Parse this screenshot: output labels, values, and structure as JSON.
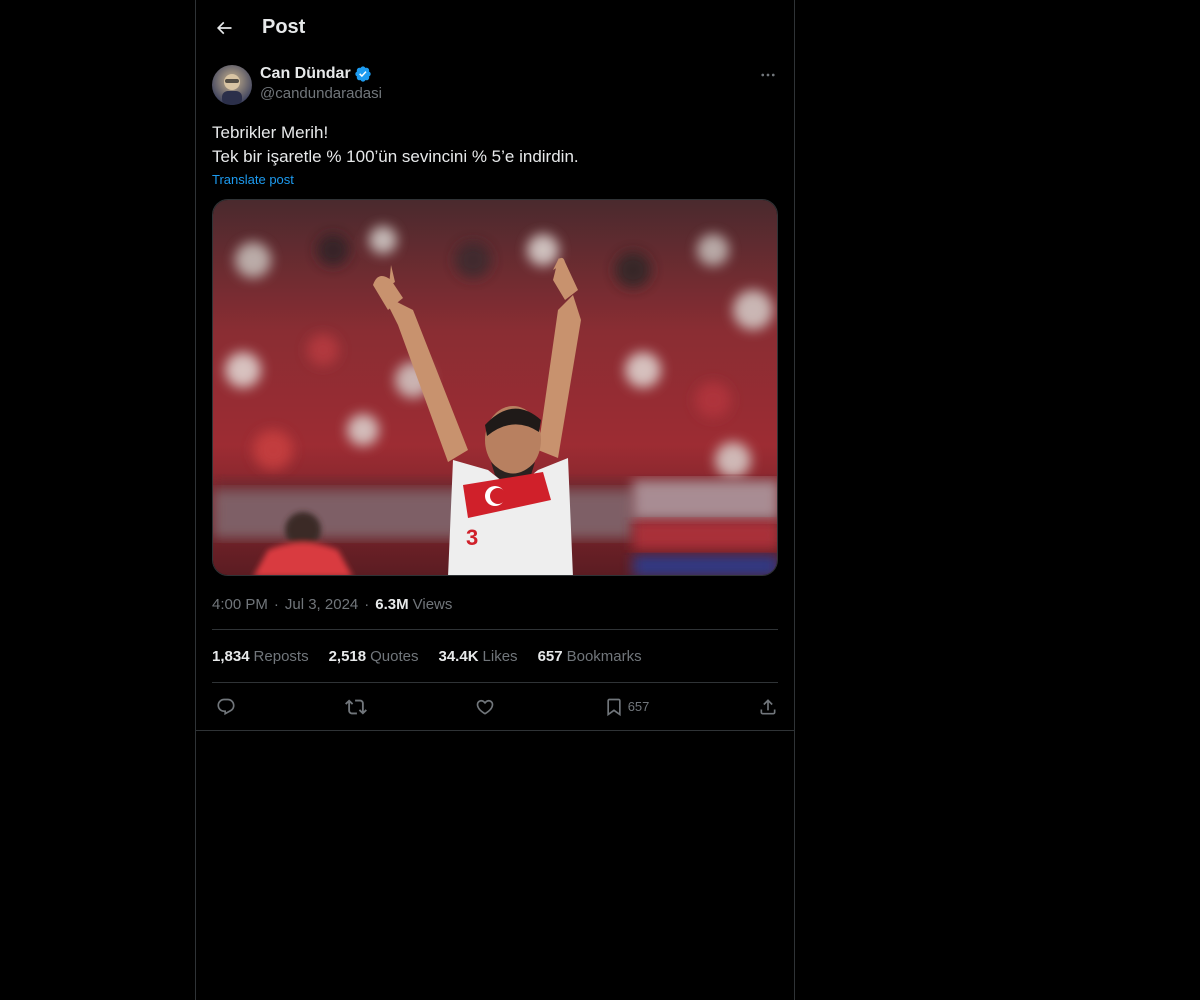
{
  "header": {
    "title": "Post"
  },
  "post": {
    "author": {
      "display_name": "Can Dündar",
      "handle": "@candundaradasi",
      "verified": true
    },
    "text_line1": "Tebrikler Merih!",
    "text_line2": "Tek bir işaretle % 100’ün sevincini % 5’e indirdin.",
    "translate_label": "Translate post",
    "time": "4:00 PM",
    "date": "Jul 3, 2024",
    "views_count": "6.3M",
    "views_label": "Views",
    "separator": "·"
  },
  "stats": {
    "reposts_count": "1,834",
    "reposts_label": "Reposts",
    "quotes_count": "2,518",
    "quotes_label": "Quotes",
    "likes_count": "34.4K",
    "likes_label": "Likes",
    "bookmarks_count": "657",
    "bookmarks_label": "Bookmarks"
  },
  "actions": {
    "bookmark_count": "657"
  },
  "icons": [
    "back-arrow-icon",
    "verified-badge-icon",
    "more-options-icon",
    "reply-icon",
    "repost-icon",
    "like-icon",
    "bookmark-icon",
    "share-icon"
  ],
  "colors": {
    "background": "#000000",
    "text": "#e7e9ea",
    "muted": "#71767b",
    "accent": "#1d9bf0",
    "border": "#2f3336"
  }
}
